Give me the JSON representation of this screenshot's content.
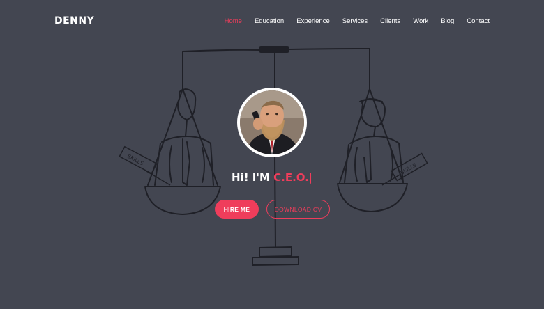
{
  "brand": {
    "name": "DENNY"
  },
  "nav": {
    "items": [
      {
        "label": "Home",
        "active": true
      },
      {
        "label": "Education",
        "active": false
      },
      {
        "label": "Experience",
        "active": false
      },
      {
        "label": "Services",
        "active": false
      },
      {
        "label": "Clients",
        "active": false
      },
      {
        "label": "Work",
        "active": false
      },
      {
        "label": "Blog",
        "active": false
      },
      {
        "label": "Contact",
        "active": false
      }
    ]
  },
  "hero": {
    "greeting_prefix": "Hi! I'M",
    "role": "C.E.O.",
    "cursor": "|",
    "hire_label": "HIRE ME",
    "cv_label": "DOWNLOAD CV",
    "sign_left": "SKILLS",
    "sign_right": "SKILLS"
  },
  "colors": {
    "background": "#434651",
    "accent": "#ef3d5b",
    "text": "#ffffff"
  }
}
